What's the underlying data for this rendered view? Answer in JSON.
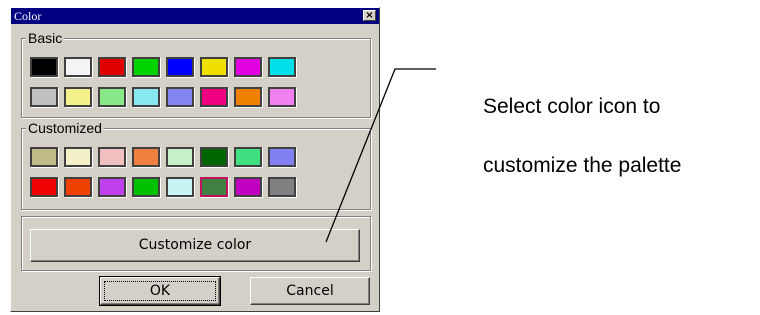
{
  "window": {
    "title": "Color"
  },
  "basic": {
    "label": "Basic",
    "swatches": [
      "#000000",
      "#f4f4f4",
      "#e00000",
      "#00d400",
      "#0000ff",
      "#f0e000",
      "#e000e0",
      "#00e0e8",
      "#c0c0c0",
      "#f4f08c",
      "#88e888",
      "#88e8f0",
      "#8484f0",
      "#f00080",
      "#f08000",
      "#f080f0"
    ]
  },
  "customized": {
    "label": "Customized",
    "swatches": [
      "#c0bc88",
      "#f4f0c8",
      "#f0c0c0",
      "#f08040",
      "#c8f0c8",
      "#006400",
      "#40e080",
      "#8080f0",
      "#f00000",
      "#f04000",
      "#c040f0",
      "#00c000",
      "#c8f4f4",
      "#408040",
      "#c000c0",
      "#808080"
    ],
    "selected_index": 13
  },
  "buttons": {
    "customize": "Customize color",
    "ok": "OK",
    "cancel": "Cancel"
  },
  "callout": {
    "line1": "Select color icon to",
    "line2": "customize the palette"
  }
}
